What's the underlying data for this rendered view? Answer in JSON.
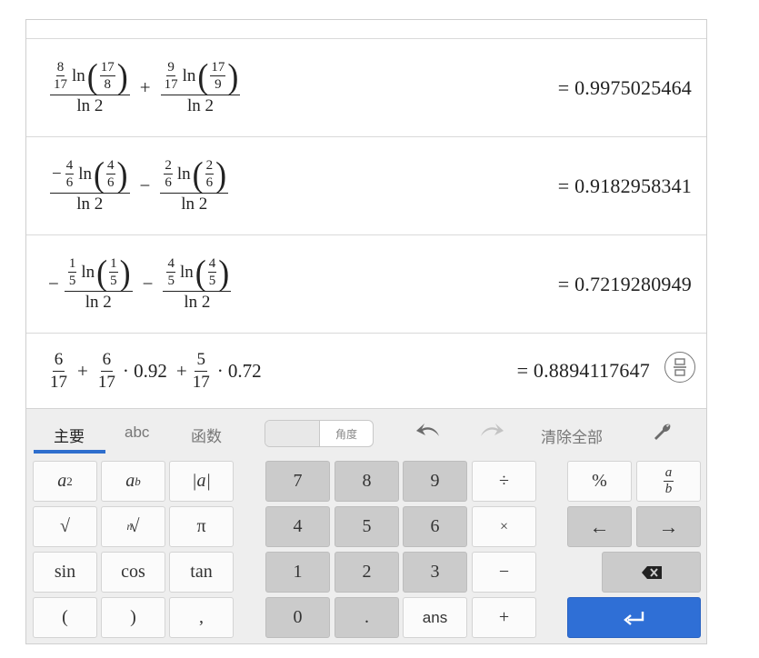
{
  "expressions": [
    {
      "result": "= 0.9975025464",
      "t1": {
        "a": "8",
        "b": "17",
        "fn": "ln",
        "c": "17",
        "d": "8",
        "den": "ln 2"
      },
      "op": "+",
      "t2": {
        "a": "9",
        "b": "17",
        "fn": "ln",
        "c": "17",
        "d": "9",
        "den": "ln 2"
      }
    },
    {
      "result": "= 0.9182958341",
      "t1": {
        "sign": "−",
        "a": "4",
        "b": "6",
        "fn": "ln",
        "c": "4",
        "d": "6",
        "den": "ln 2"
      },
      "op": "−",
      "t2": {
        "a": "2",
        "b": "6",
        "fn": "ln",
        "c": "2",
        "d": "6",
        "den": "ln 2"
      }
    },
    {
      "result": "= 0.7219280949",
      "lead": "−",
      "t1": {
        "a": "1",
        "b": "5",
        "fn": "ln",
        "c": "1",
        "d": "5",
        "den": "ln 2"
      },
      "op": "−",
      "t2": {
        "a": "4",
        "b": "5",
        "fn": "ln",
        "c": "4",
        "d": "5",
        "den": "ln 2"
      }
    }
  ],
  "last": {
    "f1": {
      "n": "6",
      "d": "17"
    },
    "op1": "+",
    "f2": {
      "n": "6",
      "d": "17"
    },
    "m1": "· 0.92",
    "op2": "+",
    "f3": {
      "n": "5",
      "d": "17"
    },
    "m2": "· 0.72",
    "result": "= 0.8894117647"
  },
  "keypad": {
    "tabs": [
      "主要",
      "abc",
      "函数"
    ],
    "active_tab": "主要",
    "degree_label": "角度",
    "clear_all": "清除全部",
    "icons": {
      "undo": "undo-arrow-icon",
      "redo": "redo-arrow-icon",
      "settings": "wrench-icon",
      "fraction_toggle": "fraction-toggle-icon"
    },
    "keys": {
      "a_sq": {
        "base": "a",
        "sup": "2"
      },
      "a_pow": {
        "base": "a",
        "sup": "b"
      },
      "abs": "|a|",
      "sqrt": "√",
      "nroot": {
        "idx": "n",
        "sym": "√"
      },
      "pi": "π",
      "sin": "sin",
      "cos": "cos",
      "tan": "tan",
      "lparen": "(",
      "rparen": ")",
      "comma": ",",
      "n7": "7",
      "n8": "8",
      "n9": "9",
      "div": "÷",
      "n4": "4",
      "n5": "5",
      "n6": "6",
      "mul": "×",
      "n1": "1",
      "n2": "2",
      "n3": "3",
      "minus": "−",
      "n0": "0",
      "point": ".",
      "ans": "ans",
      "plus": "+",
      "percent": "%",
      "frac": {
        "n": "a",
        "d": "b"
      },
      "left": "←",
      "right": "→"
    },
    "colors": {
      "accent": "#2f6fd6",
      "gray_key": "#cbcbcb",
      "panel": "#eeeeee"
    }
  }
}
